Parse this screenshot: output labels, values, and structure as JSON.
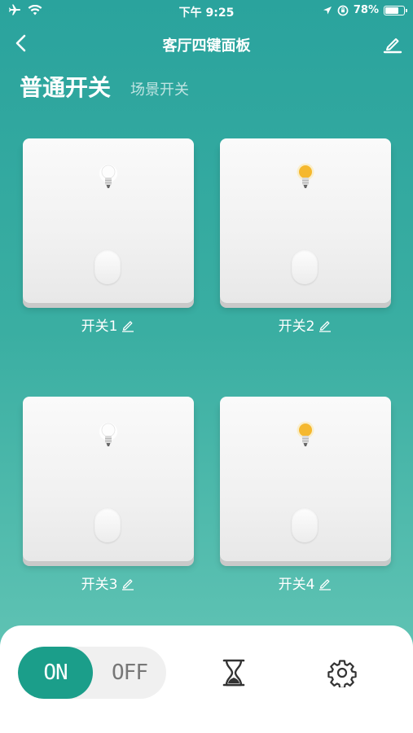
{
  "status_bar": {
    "time": "下午 9:25",
    "battery_percent": "78%",
    "battery_level": 0.78,
    "icons": [
      "airplane-icon",
      "wifi-icon",
      "location-icon",
      "orientation-lock-icon",
      "battery-icon"
    ]
  },
  "nav": {
    "title": "客厅四键面板",
    "back_icon": "chevron-left-icon",
    "edit_icon": "pencil-icon"
  },
  "tabs": {
    "active": "普通开关",
    "inactive": "场景开关"
  },
  "switches": [
    {
      "label": "开关1",
      "state": "off"
    },
    {
      "label": "开关2",
      "state": "on"
    },
    {
      "label": "开关3",
      "state": "off"
    },
    {
      "label": "开关4",
      "state": "on"
    }
  ],
  "bottom": {
    "on_label": "ON",
    "off_label": "OFF",
    "timer_icon": "hourglass-icon",
    "settings_icon": "gear-icon"
  },
  "colors": {
    "accent": "#1b9e8a",
    "background_top": "#2aa39d",
    "background_bottom": "#6cc7b9",
    "bulb_on": "#f5b82e",
    "bulb_off": "#ffffff"
  }
}
